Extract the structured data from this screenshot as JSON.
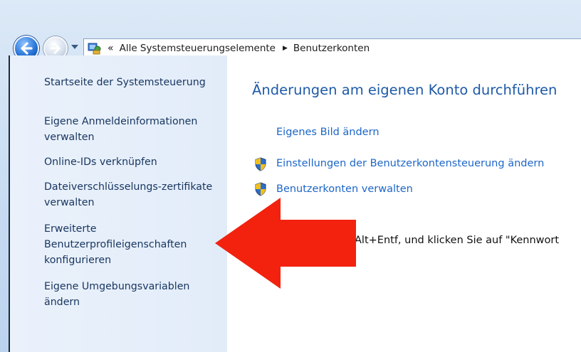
{
  "address_bar": {
    "chevron": "«",
    "crumb1": "Alle Systemsteuerungselemente",
    "separator": "▶",
    "crumb2": "Benutzerkonten"
  },
  "sidebar": {
    "items": [
      {
        "label": "Startseite der Systemsteuerung"
      },
      {
        "label": "Eigene Anmeldeinformationen verwalten"
      },
      {
        "label": "Online-IDs verknüpfen"
      },
      {
        "label": "Dateiverschlüsselungs-zertifikate verwalten"
      },
      {
        "label": "Erweiterte Benutzerprofileigenschaften konfigurieren"
      },
      {
        "label": "Eigene Umgebungsvariablen ändern"
      }
    ]
  },
  "main": {
    "heading": "Änderungen am eigenen Konto durchführen",
    "links": [
      {
        "label": "Eigenes Bild ändern"
      },
      {
        "label": "Einstellungen der Benutzerkontensteuerung ändern"
      },
      {
        "label": "Benutzerkonten verwalten"
      }
    ],
    "body_text": "Alt+Entf, und klicken Sie auf \"Kennwort"
  },
  "colors": {
    "accent": "#1e5aa8",
    "link": "#1d66c7",
    "annotation_arrow": "#f2220f"
  },
  "icons": [
    "back-arrow-icon",
    "forward-arrow-icon",
    "dropdown-icon",
    "control-panel-icon",
    "uac-shield-icon"
  ]
}
